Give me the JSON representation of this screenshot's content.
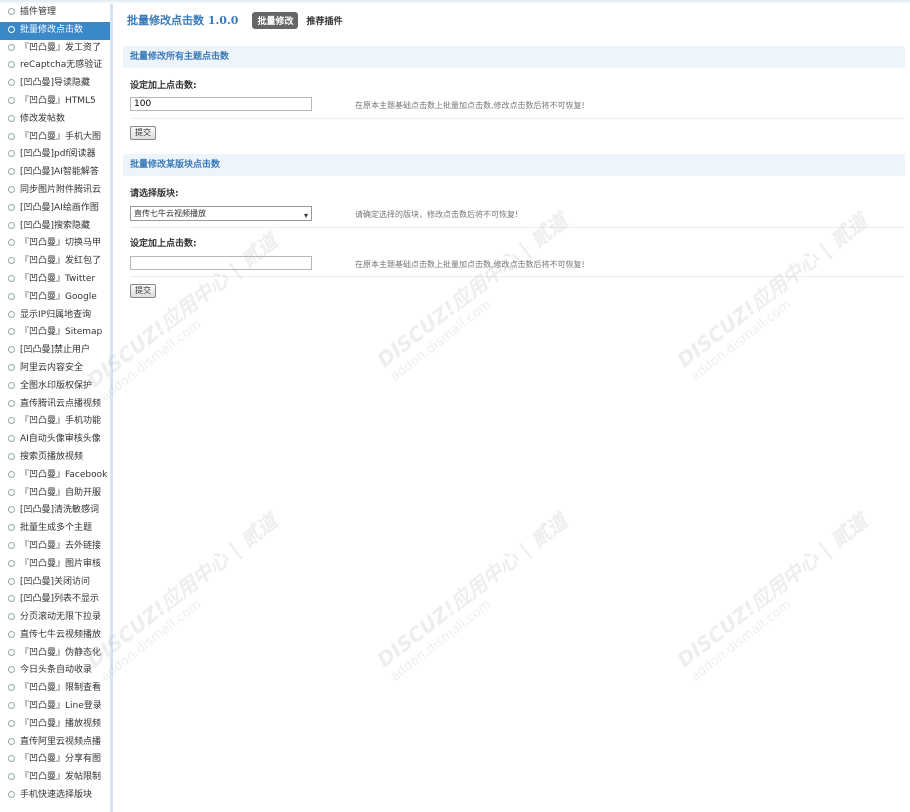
{
  "sidebar": {
    "items": [
      {
        "label": "插件管理",
        "active": false
      },
      {
        "label": "批量修改点击数",
        "active": true
      },
      {
        "label": "『凹凸曼』发工资了",
        "active": false
      },
      {
        "label": "reCaptcha无感验证",
        "active": false
      },
      {
        "label": "[凹凸曼]导读隐藏",
        "active": false
      },
      {
        "label": "『凹凸曼』HTML5",
        "active": false
      },
      {
        "label": "修改发帖数",
        "active": false
      },
      {
        "label": "『凹凸曼』手机大图",
        "active": false
      },
      {
        "label": "[凹凸曼]pdf阅读器",
        "active": false
      },
      {
        "label": "[凹凸曼]AI智能解答",
        "active": false
      },
      {
        "label": "同步图片附件腾讯云",
        "active": false
      },
      {
        "label": "[凹凸曼]AI绘画作图",
        "active": false
      },
      {
        "label": "[凹凸曼]搜索隐藏",
        "active": false
      },
      {
        "label": "『凹凸曼』切换马甲",
        "active": false
      },
      {
        "label": "『凹凸曼』发红包了",
        "active": false
      },
      {
        "label": "『凹凸曼』Twitter",
        "active": false
      },
      {
        "label": "『凹凸曼』Google",
        "active": false
      },
      {
        "label": "显示IP归属地查询",
        "active": false
      },
      {
        "label": "『凹凸曼』Sitemap",
        "active": false
      },
      {
        "label": "[凹凸曼]禁止用户",
        "active": false
      },
      {
        "label": "阿里云内容安全",
        "active": false
      },
      {
        "label": "全图水印版权保护",
        "active": false
      },
      {
        "label": "直传腾讯云点播视频",
        "active": false
      },
      {
        "label": "『凹凸曼』手机功能",
        "active": false
      },
      {
        "label": "AI自动头像审核头像",
        "active": false
      },
      {
        "label": "搜索页播放视频",
        "active": false
      },
      {
        "label": "『凹凸曼』Facebook",
        "active": false
      },
      {
        "label": "『凹凸曼』自助开服",
        "active": false
      },
      {
        "label": "[凹凸曼]清洗敏感词",
        "active": false
      },
      {
        "label": "批量生成多个主题",
        "active": false
      },
      {
        "label": "『凹凸曼』去外链接",
        "active": false
      },
      {
        "label": "『凹凸曼』图片审核",
        "active": false
      },
      {
        "label": "[凹凸曼]关闭访问",
        "active": false
      },
      {
        "label": "[凹凸曼]列表不显示",
        "active": false
      },
      {
        "label": "分页滚动无限下拉录",
        "active": false
      },
      {
        "label": "直传七牛云视频播放",
        "active": false
      },
      {
        "label": "『凹凸曼』伪静态化",
        "active": false
      },
      {
        "label": "今日头条自动收录",
        "active": false
      },
      {
        "label": "『凹凸曼』限制查看",
        "active": false
      },
      {
        "label": "『凹凸曼』Line登录",
        "active": false
      },
      {
        "label": "『凹凸曼』播放视频",
        "active": false
      },
      {
        "label": "直传阿里云视频点播",
        "active": false
      },
      {
        "label": "『凹凸曼』分享有图",
        "active": false
      },
      {
        "label": "『凹凸曼』发帖限制",
        "active": false
      },
      {
        "label": "手机快速选择版块",
        "active": false
      }
    ]
  },
  "header": {
    "title": "批量修改点击数 1.0.0",
    "tab_active": "批量修改",
    "tab_other": "推荐插件"
  },
  "section1": {
    "title": "批量修改所有主题点击数",
    "label": "设定加上点击数:",
    "input_value": "100",
    "hint": "在原本主题基础点击数上批量加点击数,修改点击数后将不可恢复!",
    "submit": "提交"
  },
  "section2": {
    "title": "批量修改某版块点击数",
    "select_label": "请选择版块:",
    "select_value": "直传七牛云视频播放",
    "select_hint": "请确定选择的版块，修改点击数后将不可恢复!",
    "label": "设定加上点击数:",
    "input_value": "",
    "hint": "在原本主题基础点击数上批量加点击数,修改点击数后将不可恢复!",
    "submit": "提交"
  },
  "watermark": {
    "line1": "DISCUZ!应用中心 | 贰道",
    "line2": "addon.dismall.com"
  }
}
